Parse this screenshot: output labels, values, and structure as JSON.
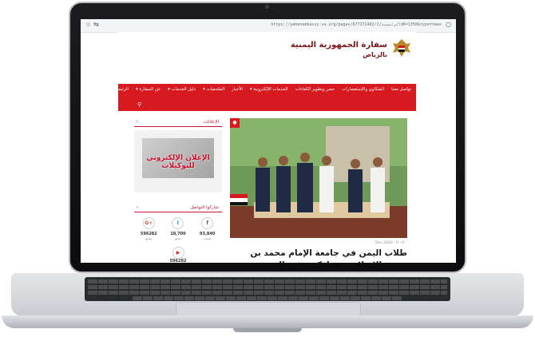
{
  "browser": {
    "url": "https://yemenembassy-sa.org/pages/677372482/الرئيسية/2d6=1350&type=news"
  },
  "site": {
    "title": "سفارة الجمهورية اليمنية",
    "subtitle": "بالرياض"
  },
  "nav": {
    "items": [
      {
        "label": "الرئيسية"
      },
      {
        "label": "عن السفارة ▾"
      },
      {
        "label": "دليل الخدمات ▾"
      },
      {
        "label": "الملحقيات ▾"
      },
      {
        "label": "الأخبار"
      },
      {
        "label": "الخدمات الإلكترونية ▾"
      },
      {
        "label": "حصر وتطوير الكفاءات"
      },
      {
        "label": "الشكاوي والإستفسارات"
      },
      {
        "label": "تواصل معنا"
      }
    ]
  },
  "sidebar": {
    "ads_heading": "الإعلانات",
    "ad_text": "الإعلان الإلكتروني للتوكيلات",
    "social_heading": "شاركوا التواصل",
    "social": [
      {
        "icon": "google-plus-icon",
        "glyph": "G+",
        "count": "596282",
        "label": "متابع",
        "color": "#dd4b39"
      },
      {
        "icon": "twitter-icon",
        "glyph": "t",
        "count": "18,700",
        "label": "متابع",
        "color": "#1da1f2"
      },
      {
        "icon": "facebook-icon",
        "glyph": "f",
        "count": "93,840",
        "label": "معجب",
        "color": "#3b5998"
      }
    ],
    "youtube": {
      "icon": "youtube-icon",
      "count": "596282"
    }
  },
  "article": {
    "meta": "Dec 2020  ·  0  ·  0",
    "headline": "طلاب اليمن في جامعة الإمام محمد بن سعود الإسلامية يشاركون في اليوم العالمي للطلاب"
  },
  "colors": {
    "brand_red": "#d71920",
    "title_maroon": "#7a1414"
  }
}
